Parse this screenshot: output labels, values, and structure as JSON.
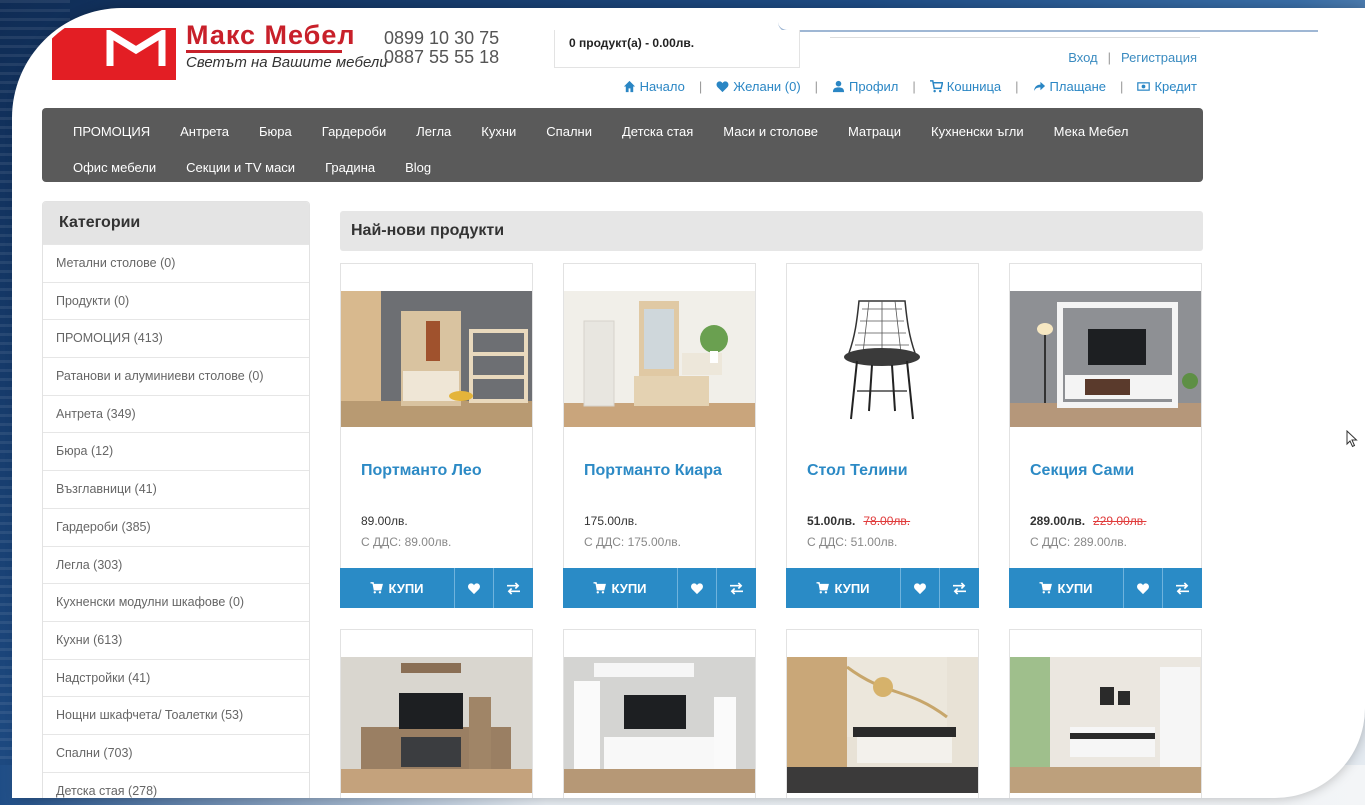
{
  "header": {
    "brand_name": "Макс Мебел",
    "slogan": "Светът на Вашите мебели",
    "phone1": "0899 10 30 75",
    "phone2": "0887 55 55 18",
    "cart_summary": "0 продукт(а) - 0.00лв.",
    "login": "Вход",
    "separator": "|",
    "register": "Регистрация"
  },
  "topnav": {
    "home": "Начало",
    "wishlist": "Желани (0)",
    "profile": "Профил",
    "cart": "Кошница",
    "checkout": "Плащане",
    "credit": "Кредит",
    "separator": "|"
  },
  "mainnav": {
    "items": [
      "ПРОМОЦИЯ",
      "Антрета",
      "Бюра",
      "Гардероби",
      "Легла",
      "Кухни",
      "Спални",
      "Детска стая",
      "Маси и столове",
      "Матраци",
      "Кухненски ъгли",
      "Мека Мебел",
      "Офис мебели",
      "Секции и TV маси",
      "Градина",
      "Blog"
    ]
  },
  "sidebar": {
    "title": "Категории",
    "items": [
      "Метални столове (0)",
      "Продукти (0)",
      "ПРОМОЦИЯ (413)",
      "Ратанови и алуминиеви столове (0)",
      "Антрета (349)",
      "Бюра (12)",
      "Възглавници (41)",
      "Гардероби (385)",
      "Легла (303)",
      "Кухненски модулни шкафове (0)",
      "Кухни (613)",
      "Надстройки (41)",
      "Нощни шкафчета/ Тоалетки (53)",
      "Спални (703)",
      "Детска стая (278)"
    ]
  },
  "content": {
    "section_title": "Най-нови продукти",
    "buy_label": "КУПИ",
    "products": [
      {
        "name": "Портманто Лео",
        "price": "89.00лв.",
        "old_price": "",
        "vat": "С ДДС: 89.00лв."
      },
      {
        "name": "Портманто Киара",
        "price": "175.00лв.",
        "old_price": "",
        "vat": "С ДДС: 175.00лв."
      },
      {
        "name": "Стол Телини",
        "price": "51.00лв.",
        "old_price": "78.00лв.",
        "vat": "С ДДС: 51.00лв."
      },
      {
        "name": "Секция Сами",
        "price": "289.00лв.",
        "old_price": "229.00лв.",
        "vat": "С ДДС: 289.00лв."
      }
    ]
  },
  "colors": {
    "accent": "#2a8bc6",
    "brand_red": "#e31e24",
    "nav_bg": "#5a5a5a"
  }
}
